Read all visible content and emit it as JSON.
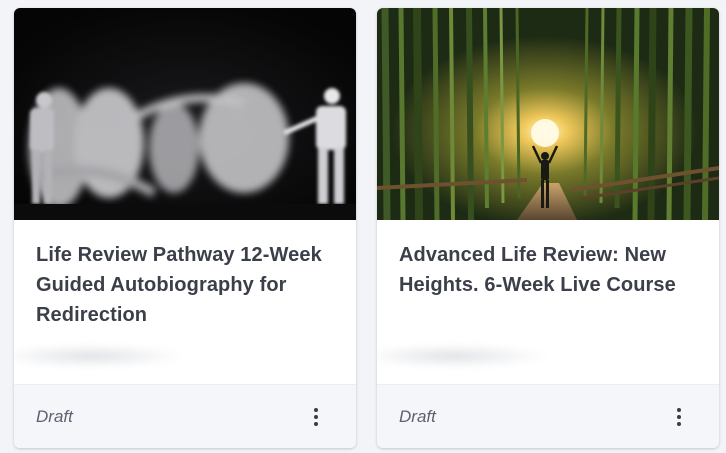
{
  "courses": [
    {
      "title": "Life Review Pathway 12-Week Guided Autobiography for Redirection",
      "status": "Draft",
      "image_icon": "fencing-photo",
      "menu_icon": "more-vertical-icon"
    },
    {
      "title": "Advanced Life Review: New Heights. 6-Week Live Course",
      "status": "Draft",
      "image_icon": "bamboo-forest-photo",
      "menu_icon": "more-vertical-icon"
    }
  ],
  "colors": {
    "page_bg": "#f3f4f8",
    "card_bg": "#ffffff",
    "footer_bg": "#f5f6fa",
    "title_text": "#3b3f4a",
    "status_text": "#5d6270"
  }
}
